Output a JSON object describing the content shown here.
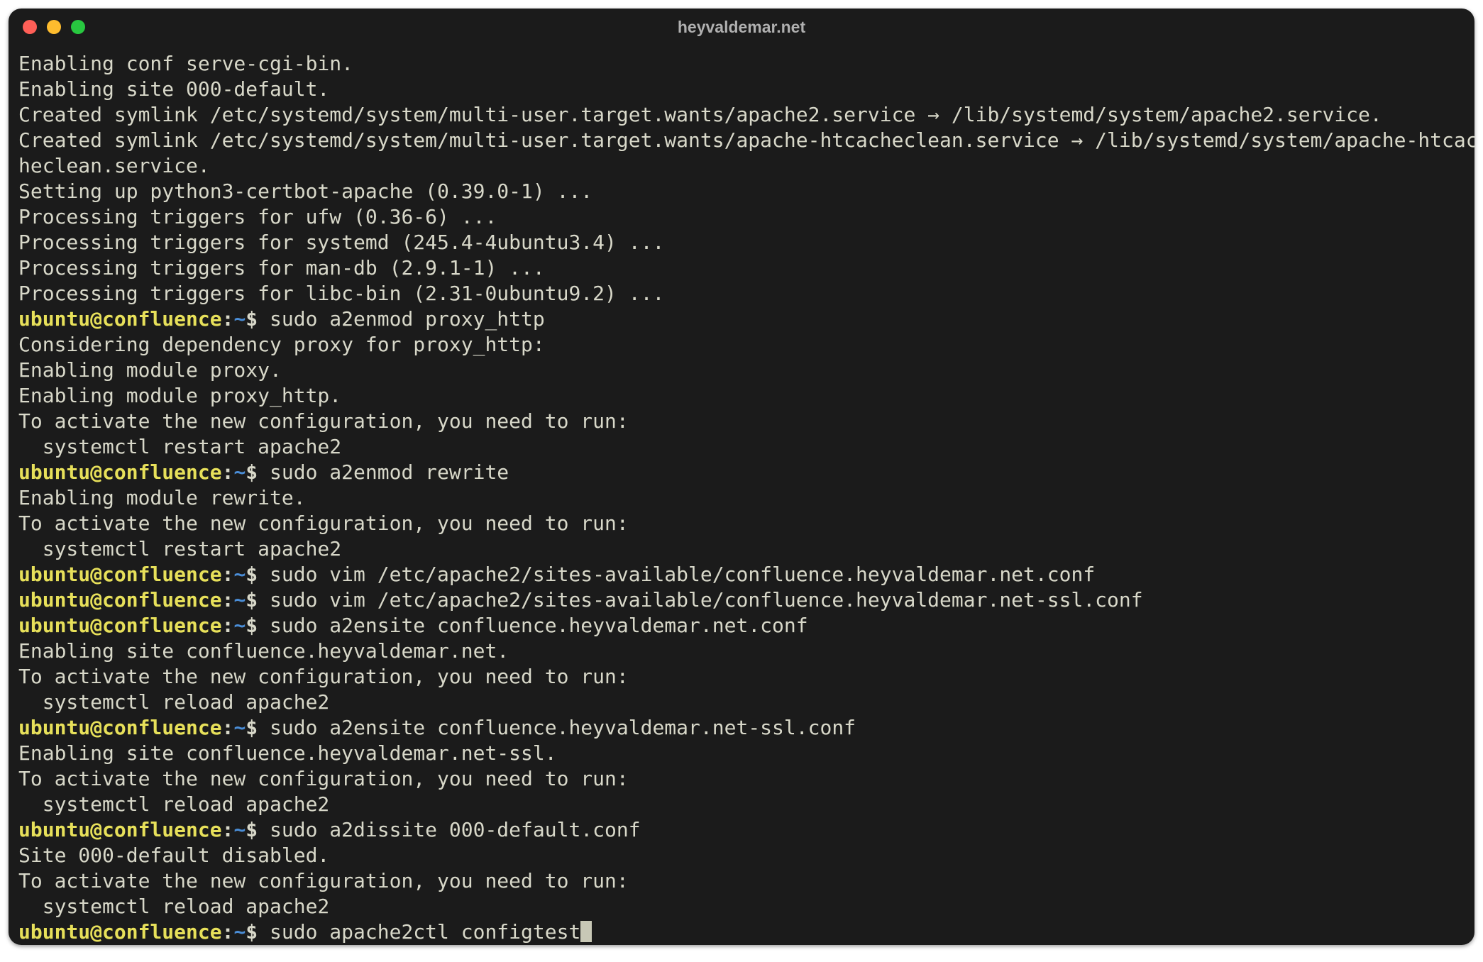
{
  "window": {
    "title": "heyvaldemar.net"
  },
  "prompt": {
    "user_host": "ubuntu@confluence",
    "separator": ":",
    "path": "~",
    "symbol": "$"
  },
  "lines": [
    {
      "type": "out",
      "text": "Enabling conf serve-cgi-bin."
    },
    {
      "type": "out",
      "text": "Enabling site 000-default."
    },
    {
      "type": "out",
      "text": "Created symlink /etc/systemd/system/multi-user.target.wants/apache2.service → /lib/systemd/system/apache2.service."
    },
    {
      "type": "out",
      "text": "Created symlink /etc/systemd/system/multi-user.target.wants/apache-htcacheclean.service → /lib/systemd/system/apache-htcacheclean.service."
    },
    {
      "type": "out",
      "text": "Setting up python3-certbot-apache (0.39.0-1) ..."
    },
    {
      "type": "out",
      "text": "Processing triggers for ufw (0.36-6) ..."
    },
    {
      "type": "out",
      "text": "Processing triggers for systemd (245.4-4ubuntu3.4) ..."
    },
    {
      "type": "out",
      "text": "Processing triggers for man-db (2.9.1-1) ..."
    },
    {
      "type": "out",
      "text": "Processing triggers for libc-bin (2.31-0ubuntu9.2) ..."
    },
    {
      "type": "cmd",
      "command": "sudo a2enmod proxy_http"
    },
    {
      "type": "out",
      "text": "Considering dependency proxy for proxy_http:"
    },
    {
      "type": "out",
      "text": "Enabling module proxy."
    },
    {
      "type": "out",
      "text": "Enabling module proxy_http."
    },
    {
      "type": "out",
      "text": "To activate the new configuration, you need to run:"
    },
    {
      "type": "out",
      "text": "  systemctl restart apache2"
    },
    {
      "type": "cmd",
      "command": "sudo a2enmod rewrite"
    },
    {
      "type": "out",
      "text": "Enabling module rewrite."
    },
    {
      "type": "out",
      "text": "To activate the new configuration, you need to run:"
    },
    {
      "type": "out",
      "text": "  systemctl restart apache2"
    },
    {
      "type": "cmd",
      "command": "sudo vim /etc/apache2/sites-available/confluence.heyvaldemar.net.conf"
    },
    {
      "type": "cmd",
      "command": "sudo vim /etc/apache2/sites-available/confluence.heyvaldemar.net-ssl.conf"
    },
    {
      "type": "cmd",
      "command": "sudo a2ensite confluence.heyvaldemar.net.conf"
    },
    {
      "type": "out",
      "text": "Enabling site confluence.heyvaldemar.net."
    },
    {
      "type": "out",
      "text": "To activate the new configuration, you need to run:"
    },
    {
      "type": "out",
      "text": "  systemctl reload apache2"
    },
    {
      "type": "cmd",
      "command": "sudo a2ensite confluence.heyvaldemar.net-ssl.conf"
    },
    {
      "type": "out",
      "text": "Enabling site confluence.heyvaldemar.net-ssl."
    },
    {
      "type": "out",
      "text": "To activate the new configuration, you need to run:"
    },
    {
      "type": "out",
      "text": "  systemctl reload apache2"
    },
    {
      "type": "cmd",
      "command": "sudo a2dissite 000-default.conf"
    },
    {
      "type": "out",
      "text": "Site 000-default disabled."
    },
    {
      "type": "out",
      "text": "To activate the new configuration, you need to run:"
    },
    {
      "type": "out",
      "text": "  systemctl reload apache2"
    },
    {
      "type": "cmd",
      "command": "sudo apache2ctl configtest",
      "cursor": true
    }
  ]
}
